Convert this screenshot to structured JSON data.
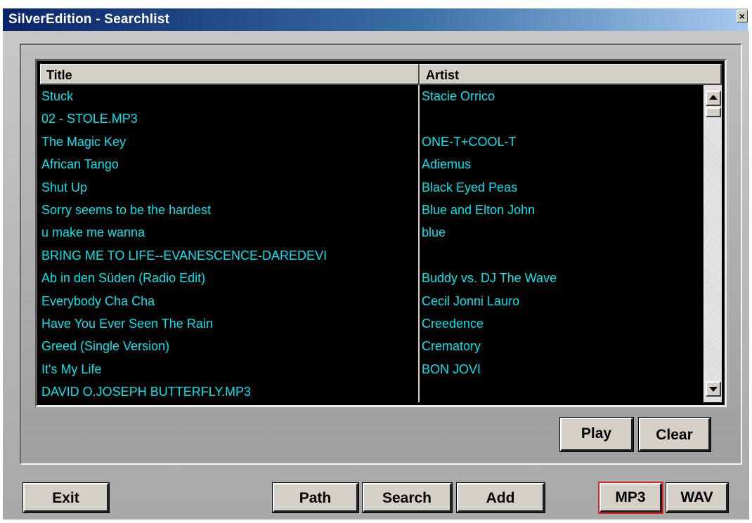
{
  "window": {
    "title": "SilverEdition - Searchlist",
    "close_glyph": "×"
  },
  "list": {
    "columns": [
      "Title",
      "Artist"
    ],
    "rows": [
      {
        "title": "Stuck",
        "artist": "Stacie Orrico"
      },
      {
        "title": "02 - STOLE.MP3",
        "artist": ""
      },
      {
        "title": " The Magic Key",
        "artist": "ONE-T+COOL-T"
      },
      {
        "title": "African Tango",
        "artist": "Adiemus"
      },
      {
        "title": "Shut Up",
        "artist": "Black Eyed Peas"
      },
      {
        "title": "Sorry seems to be the hardest",
        "artist": "Blue and Elton John"
      },
      {
        "title": "u make me wanna",
        "artist": "blue"
      },
      {
        "title": "BRING ME TO LIFE--EVANESCENCE-DAREDEVI",
        "artist": ""
      },
      {
        "title": "Ab in den Süden (Radio Edit)",
        "artist": "Buddy vs. DJ The Wave"
      },
      {
        "title": "Everybody Cha Cha",
        "artist": "Cecil Jonni Lauro"
      },
      {
        "title": "Have You Ever Seen The Rain",
        "artist": "Creedence"
      },
      {
        "title": "Greed (Single Version)",
        "artist": "Crematory"
      },
      {
        "title": "It's My Life",
        "artist": "BON JOVI"
      },
      {
        "title": "DAVID O.JOSEPH BUTTERFLY.MP3",
        "artist": ""
      }
    ],
    "text_color": "#00e5ee",
    "background": "#000000"
  },
  "buttons": {
    "play": "Play",
    "clear": "Clear",
    "exit": "Exit",
    "path": "Path",
    "search": "Search",
    "add": "Add",
    "mp3": "MP3",
    "wav": "WAV"
  },
  "format": {
    "selected": "MP3",
    "selected_outline_color": "#e02020"
  }
}
